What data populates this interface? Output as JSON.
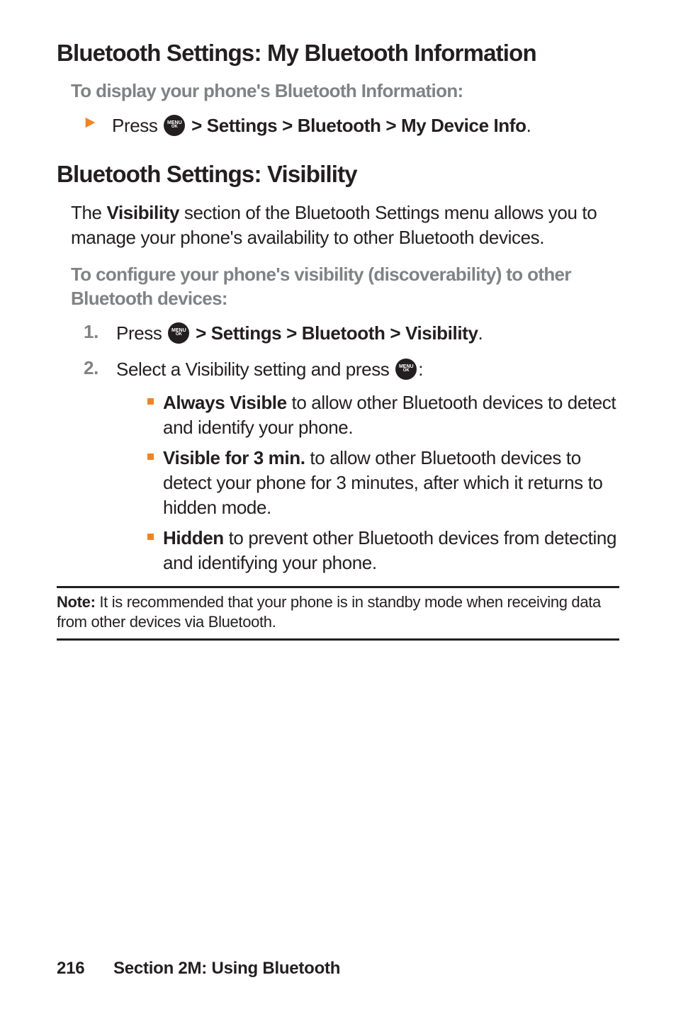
{
  "heading1": "Bluetooth Settings: My Bluetooth Information",
  "subhead1": "To display your phone's Bluetooth Information:",
  "instr1_press": "Press ",
  "instr1_path": " > Settings > Bluetooth > My Device Info",
  "instr1_end": ".",
  "heading2": "Bluetooth Settings: Visibility",
  "para1_pre": "The ",
  "para1_bold": "Visibility",
  "para1_post": " section of the Bluetooth Settings menu allows you to manage your phone's availability to other Bluetooth devices.",
  "subhead2": "To configure your phone's visibility (discoverability) to other Bluetooth devices:",
  "step1_num": "1.",
  "step1_press": "Press ",
  "step1_path": " > Settings > Bluetooth > Visibility",
  "step1_end": ".",
  "step2_num": "2.",
  "step2_text": "Select a Visibility setting and press ",
  "step2_end": ":",
  "bullets": [
    {
      "bold": "Always Visible",
      "rest": " to allow other Bluetooth devices to detect and identify your phone."
    },
    {
      "bold": "Visible for 3 min.",
      "rest": " to allow other Bluetooth devices to detect your phone for 3 minutes, after which it returns to hidden mode."
    },
    {
      "bold": "Hidden",
      "rest": " to prevent other Bluetooth devices from detecting and identifying your phone."
    }
  ],
  "note_label": "Note:",
  "note_text": " It is recommended that your phone is in standby mode when receiving data from other devices via Bluetooth.",
  "footer_page": "216",
  "footer_section": "Section 2M: Using Bluetooth",
  "icon_menu": "MENU",
  "icon_ok": "OK"
}
